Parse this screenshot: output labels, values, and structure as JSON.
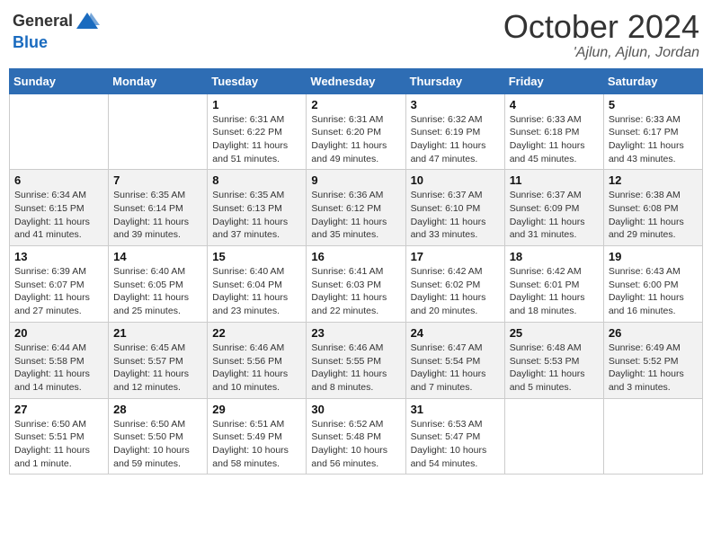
{
  "header": {
    "logo_general": "General",
    "logo_blue": "Blue",
    "month": "October 2024",
    "location": "'Ajlun, Ajlun, Jordan"
  },
  "weekdays": [
    "Sunday",
    "Monday",
    "Tuesday",
    "Wednesday",
    "Thursday",
    "Friday",
    "Saturday"
  ],
  "weeks": [
    [
      {
        "day": "",
        "info": ""
      },
      {
        "day": "",
        "info": ""
      },
      {
        "day": "1",
        "info": "Sunrise: 6:31 AM\nSunset: 6:22 PM\nDaylight: 11 hours and 51 minutes."
      },
      {
        "day": "2",
        "info": "Sunrise: 6:31 AM\nSunset: 6:20 PM\nDaylight: 11 hours and 49 minutes."
      },
      {
        "day": "3",
        "info": "Sunrise: 6:32 AM\nSunset: 6:19 PM\nDaylight: 11 hours and 47 minutes."
      },
      {
        "day": "4",
        "info": "Sunrise: 6:33 AM\nSunset: 6:18 PM\nDaylight: 11 hours and 45 minutes."
      },
      {
        "day": "5",
        "info": "Sunrise: 6:33 AM\nSunset: 6:17 PM\nDaylight: 11 hours and 43 minutes."
      }
    ],
    [
      {
        "day": "6",
        "info": "Sunrise: 6:34 AM\nSunset: 6:15 PM\nDaylight: 11 hours and 41 minutes."
      },
      {
        "day": "7",
        "info": "Sunrise: 6:35 AM\nSunset: 6:14 PM\nDaylight: 11 hours and 39 minutes."
      },
      {
        "day": "8",
        "info": "Sunrise: 6:35 AM\nSunset: 6:13 PM\nDaylight: 11 hours and 37 minutes."
      },
      {
        "day": "9",
        "info": "Sunrise: 6:36 AM\nSunset: 6:12 PM\nDaylight: 11 hours and 35 minutes."
      },
      {
        "day": "10",
        "info": "Sunrise: 6:37 AM\nSunset: 6:10 PM\nDaylight: 11 hours and 33 minutes."
      },
      {
        "day": "11",
        "info": "Sunrise: 6:37 AM\nSunset: 6:09 PM\nDaylight: 11 hours and 31 minutes."
      },
      {
        "day": "12",
        "info": "Sunrise: 6:38 AM\nSunset: 6:08 PM\nDaylight: 11 hours and 29 minutes."
      }
    ],
    [
      {
        "day": "13",
        "info": "Sunrise: 6:39 AM\nSunset: 6:07 PM\nDaylight: 11 hours and 27 minutes."
      },
      {
        "day": "14",
        "info": "Sunrise: 6:40 AM\nSunset: 6:05 PM\nDaylight: 11 hours and 25 minutes."
      },
      {
        "day": "15",
        "info": "Sunrise: 6:40 AM\nSunset: 6:04 PM\nDaylight: 11 hours and 23 minutes."
      },
      {
        "day": "16",
        "info": "Sunrise: 6:41 AM\nSunset: 6:03 PM\nDaylight: 11 hours and 22 minutes."
      },
      {
        "day": "17",
        "info": "Sunrise: 6:42 AM\nSunset: 6:02 PM\nDaylight: 11 hours and 20 minutes."
      },
      {
        "day": "18",
        "info": "Sunrise: 6:42 AM\nSunset: 6:01 PM\nDaylight: 11 hours and 18 minutes."
      },
      {
        "day": "19",
        "info": "Sunrise: 6:43 AM\nSunset: 6:00 PM\nDaylight: 11 hours and 16 minutes."
      }
    ],
    [
      {
        "day": "20",
        "info": "Sunrise: 6:44 AM\nSunset: 5:58 PM\nDaylight: 11 hours and 14 minutes."
      },
      {
        "day": "21",
        "info": "Sunrise: 6:45 AM\nSunset: 5:57 PM\nDaylight: 11 hours and 12 minutes."
      },
      {
        "day": "22",
        "info": "Sunrise: 6:46 AM\nSunset: 5:56 PM\nDaylight: 11 hours and 10 minutes."
      },
      {
        "day": "23",
        "info": "Sunrise: 6:46 AM\nSunset: 5:55 PM\nDaylight: 11 hours and 8 minutes."
      },
      {
        "day": "24",
        "info": "Sunrise: 6:47 AM\nSunset: 5:54 PM\nDaylight: 11 hours and 7 minutes."
      },
      {
        "day": "25",
        "info": "Sunrise: 6:48 AM\nSunset: 5:53 PM\nDaylight: 11 hours and 5 minutes."
      },
      {
        "day": "26",
        "info": "Sunrise: 6:49 AM\nSunset: 5:52 PM\nDaylight: 11 hours and 3 minutes."
      }
    ],
    [
      {
        "day": "27",
        "info": "Sunrise: 6:50 AM\nSunset: 5:51 PM\nDaylight: 11 hours and 1 minute."
      },
      {
        "day": "28",
        "info": "Sunrise: 6:50 AM\nSunset: 5:50 PM\nDaylight: 10 hours and 59 minutes."
      },
      {
        "day": "29",
        "info": "Sunrise: 6:51 AM\nSunset: 5:49 PM\nDaylight: 10 hours and 58 minutes."
      },
      {
        "day": "30",
        "info": "Sunrise: 6:52 AM\nSunset: 5:48 PM\nDaylight: 10 hours and 56 minutes."
      },
      {
        "day": "31",
        "info": "Sunrise: 6:53 AM\nSunset: 5:47 PM\nDaylight: 10 hours and 54 minutes."
      },
      {
        "day": "",
        "info": ""
      },
      {
        "day": "",
        "info": ""
      }
    ]
  ]
}
